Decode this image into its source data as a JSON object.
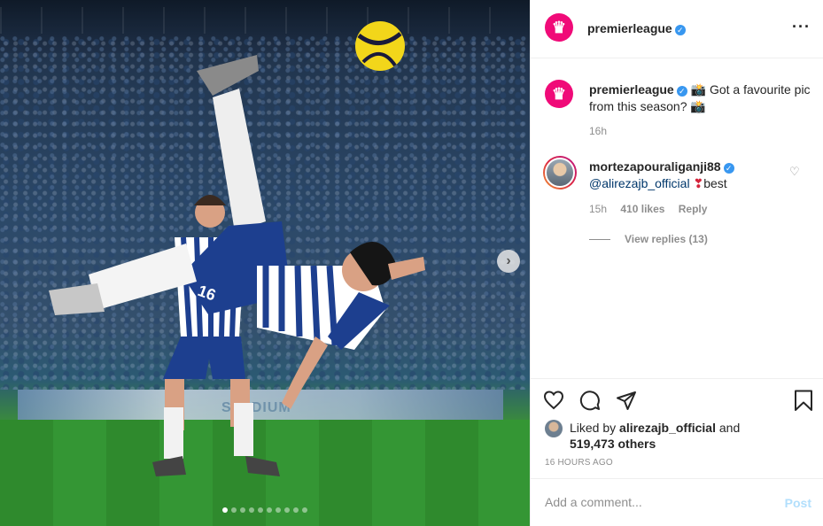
{
  "post": {
    "author": "premierleague",
    "author_verified": true,
    "more_icon": "more-horizontal-icon",
    "caption_prefix_icon": "camera-emoji",
    "caption": "Got a favourite pic from this season?",
    "caption_suffix_icon": "camera-emoji",
    "caption_time": "16h",
    "image": {
      "board_text": "STADIUM",
      "player_number": "16",
      "next_icon": "chevron-right-icon",
      "carousel_count": 10,
      "carousel_active": 0
    }
  },
  "comments": [
    {
      "username": "mortezapouraliganji88",
      "verified": true,
      "mention": "@alirezajb_official",
      "emoji": "❣",
      "text": "best",
      "time": "15h",
      "likes": "410 likes",
      "reply_label": "Reply",
      "view_replies": "View replies (13)"
    }
  ],
  "actions": {
    "like_icon": "heart-icon",
    "comment_icon": "comment-icon",
    "share_icon": "send-icon",
    "save_icon": "bookmark-icon"
  },
  "likes": {
    "prefix": "Liked by",
    "liker": "alirezajb_official",
    "joiner": "and",
    "others": "519,473 others"
  },
  "time_ago": "16 HOURS AGO",
  "add_comment": {
    "placeholder": "Add a comment...",
    "post_label": "Post"
  },
  "colors": {
    "brand": "#f00a78",
    "verified": "#3897f0",
    "link": "#00376b",
    "post_disabled": "#b2dffc"
  }
}
